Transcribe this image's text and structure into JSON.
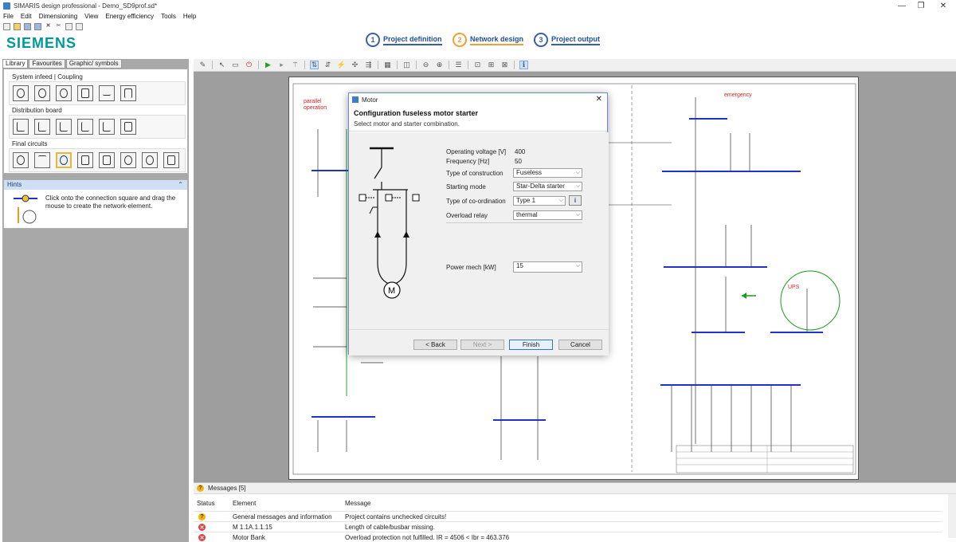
{
  "window": {
    "title": "SIMARIS design professional - Demo_SD9prof.sd*",
    "min": "—",
    "max": "❐",
    "close": "✕"
  },
  "menu": [
    "File",
    "Edit",
    "Dimensioning",
    "View",
    "Energy efficiency",
    "Tools",
    "Help"
  ],
  "brand": "SIEMENS",
  "steps": [
    {
      "num": "1",
      "label": "Project definition"
    },
    {
      "num": "2",
      "label": "Network design"
    },
    {
      "num": "3",
      "label": "Project output"
    }
  ],
  "library": {
    "tabs": [
      "Library",
      "Favourites",
      "Graphic/ symbols"
    ],
    "groups": [
      {
        "title": "System infeed | Coupling",
        "count": 6
      },
      {
        "title": "Distribution board",
        "count": 6
      },
      {
        "title": "Final circuits",
        "count": 8
      }
    ]
  },
  "hints": {
    "title": "Hints",
    "collapse": "⌃",
    "text": "Click onto the connection square and drag the mouse to create the network-element."
  },
  "diagram": {
    "parallel": "parallel operation",
    "emergency": "emergency",
    "ups": "UPS"
  },
  "dialog": {
    "title": "Motor",
    "heading": "Configuration fuseless motor starter",
    "subheading": "Select motor and starter combination.",
    "fields": {
      "voltage": {
        "label": "Operating voltage [V]",
        "value": "400"
      },
      "frequency": {
        "label": "Frequency [Hz]",
        "value": "50"
      },
      "construction": {
        "label": "Type of construction",
        "value": "Fuseless"
      },
      "starting": {
        "label": "Starting mode",
        "value": "Star-Delta starter"
      },
      "coordination": {
        "label": "Type of co-ordination",
        "value": "Type 1"
      },
      "overload": {
        "label": "Overload relay",
        "value": "thermal"
      },
      "power": {
        "label": "Power mech [kW]",
        "value": "15"
      }
    },
    "info": "i",
    "buttons": {
      "back": "< Back",
      "next": "Next >",
      "finish": "Finish",
      "cancel": "Cancel"
    }
  },
  "messages": {
    "title": "Messages [5]",
    "columns": [
      "Status",
      "Element",
      "Message"
    ],
    "rows": [
      {
        "status": "warning",
        "element": "General messages and information",
        "message": "Project contains unchecked circuits!"
      },
      {
        "status": "error",
        "element": "M 1.1A.1.1.15",
        "message": "Length of cable/busbar missing."
      },
      {
        "status": "error",
        "element": "Motor Bank",
        "message": "Overload protection not fulfilled. IR = 4506 < Ibr = 463.376"
      }
    ]
  },
  "colors": {
    "busbar": "#2233cc",
    "accent": "#009999",
    "redtext": "#e02020",
    "green": "#1a9a1a"
  }
}
